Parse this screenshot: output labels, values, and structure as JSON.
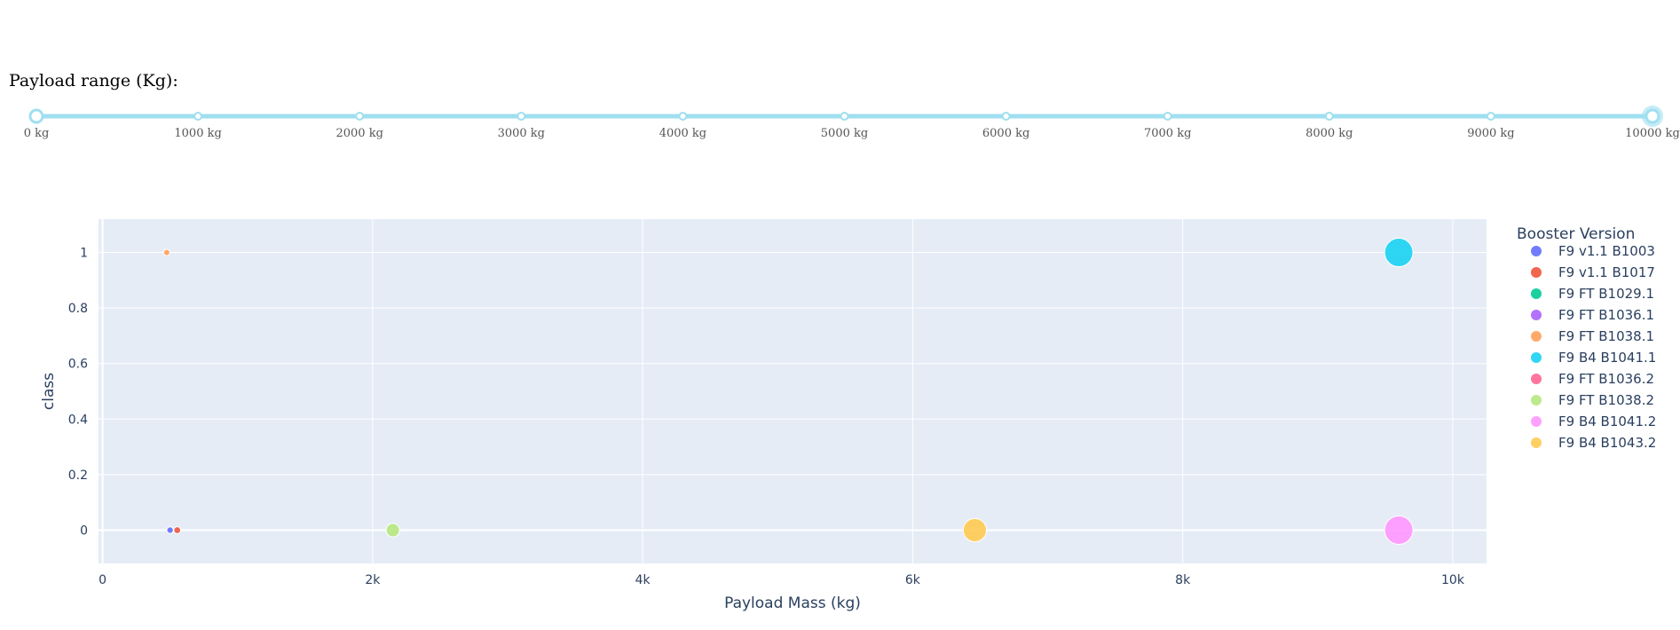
{
  "slider": {
    "label": "Payload range (Kg):",
    "min": 0,
    "max": 10000,
    "value": [
      0,
      10000
    ],
    "marks": [
      "0 kg",
      "1000 kg",
      "2000 kg",
      "3000 kg",
      "4000 kg",
      "5000 kg",
      "6000 kg",
      "7000 kg",
      "8000 kg",
      "9000 kg",
      "10000 kg"
    ],
    "track_color": "#9fdff0",
    "handle_color": "#9fdff0"
  },
  "chart_data": {
    "type": "scatter",
    "xlabel": "Payload Mass (kg)",
    "ylabel": "class",
    "xlim": [
      -30,
      10250
    ],
    "ylim": [
      -0.12,
      1.12
    ],
    "x_ticks": [
      0,
      2000,
      4000,
      6000,
      8000,
      10000
    ],
    "x_tick_labels": [
      "0",
      "2k",
      "4k",
      "6k",
      "8k",
      "10k"
    ],
    "y_ticks": [
      0,
      0.2,
      0.4,
      0.6,
      0.8,
      1
    ],
    "y_tick_labels": [
      "0",
      "0.2",
      "0.4",
      "0.6",
      "0.8",
      "1"
    ],
    "grid": true,
    "legend_title": "Booster Version",
    "legend_placement": "right",
    "series": [
      {
        "name": "F9 v1.1  B1003",
        "color": "#636efa",
        "points": [
          {
            "x": 500,
            "y": 0
          }
        ]
      },
      {
        "name": "F9 v1.1 B1017",
        "color": "#ef553b",
        "points": [
          {
            "x": 553,
            "y": 0
          }
        ]
      },
      {
        "name": "F9 FT B1029.1",
        "color": "#00cc96",
        "points": []
      },
      {
        "name": "F9 FT B1036.1",
        "color": "#ab63fa",
        "points": []
      },
      {
        "name": "F9 FT B1038.1",
        "color": "#ffa15a",
        "points": [
          {
            "x": 475,
            "y": 1
          }
        ]
      },
      {
        "name": "F9 B4 B1041.1",
        "color": "#19d3f3",
        "points": [
          {
            "x": 9600,
            "y": 1
          }
        ]
      },
      {
        "name": "F9 FT  B1036.2",
        "color": "#ff6692",
        "points": []
      },
      {
        "name": "F9 FT  B1038.2",
        "color": "#b6e880",
        "points": [
          {
            "x": 2150,
            "y": 0
          }
        ]
      },
      {
        "name": "F9 B4  B1041.2",
        "color": "#ff97ff",
        "points": [
          {
            "x": 9600,
            "y": 0
          }
        ]
      },
      {
        "name": "F9 B4  B1043.2",
        "color": "#fecb52",
        "points": [
          {
            "x": 6460,
            "y": 0
          }
        ]
      }
    ]
  }
}
